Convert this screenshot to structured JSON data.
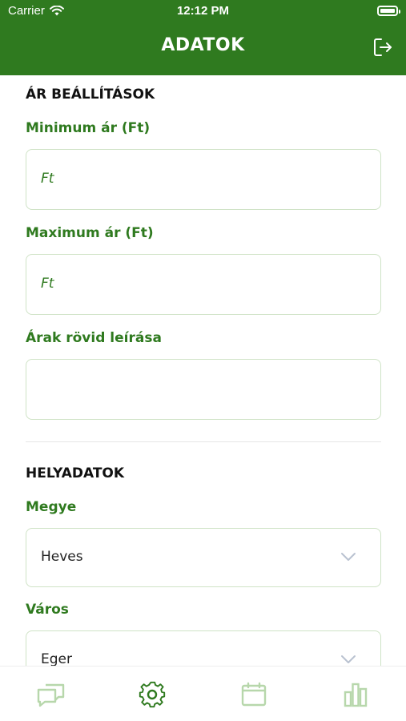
{
  "status_bar": {
    "carrier": "Carrier",
    "time": "12:12 PM"
  },
  "header": {
    "title": "ADATOK",
    "logout_icon": "logout-icon"
  },
  "price_settings": {
    "section_title": "ÁR BEÁLLÍTÁSOK",
    "min_price": {
      "label": "Minimum ár (Ft)",
      "placeholder": "Ft",
      "value": ""
    },
    "max_price": {
      "label": "Maximum ár (Ft)",
      "placeholder": "Ft",
      "value": ""
    },
    "description": {
      "label": "Árak rövid leírása",
      "value": ""
    }
  },
  "location": {
    "section_title": "HELYADATOK",
    "county": {
      "label": "Megye",
      "value": "Heves"
    },
    "city": {
      "label": "Város",
      "value": "Eger"
    }
  },
  "tabbar": {
    "tabs": [
      {
        "icon": "chat-icon",
        "active": false
      },
      {
        "icon": "gear-icon",
        "active": true
      },
      {
        "icon": "calendar-icon",
        "active": false
      },
      {
        "icon": "bar-chart-icon",
        "active": false
      }
    ]
  },
  "colors": {
    "brand_green": "#2f7a1f",
    "inactive_tab": "#b7d7ab",
    "border_green": "#cfe3c6"
  }
}
